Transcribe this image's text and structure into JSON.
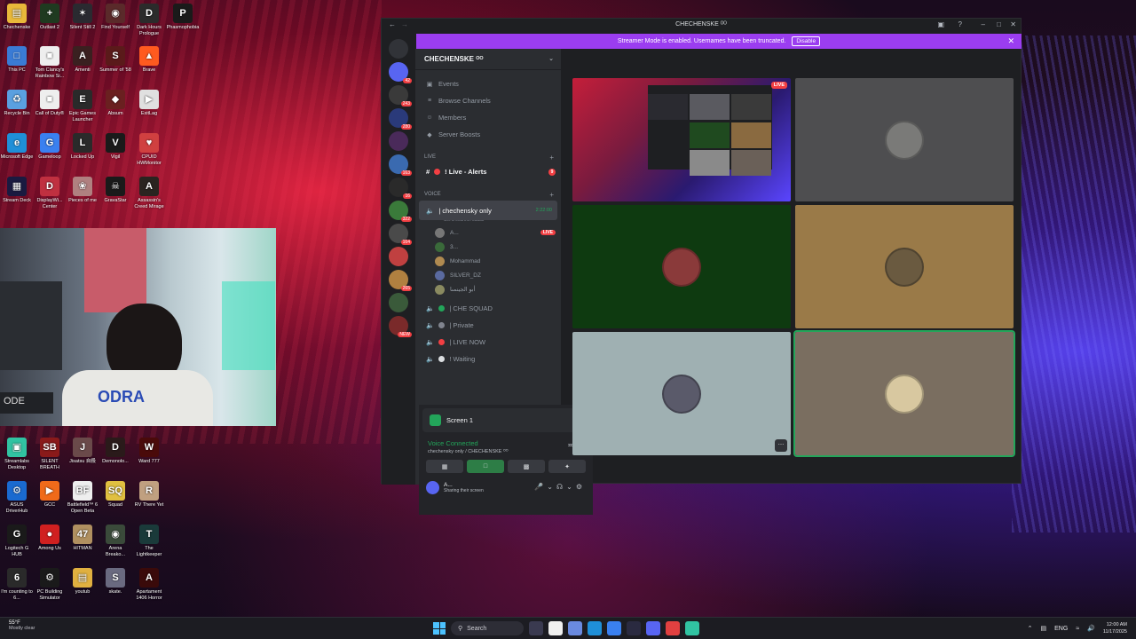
{
  "desktop": {
    "icons": [
      {
        "label": "Chechenske",
        "color": "#e8b83a",
        "glyph": "▤"
      },
      {
        "label": "Outlast 2",
        "color": "#1f3a20",
        "glyph": "+"
      },
      {
        "label": "Silent Still 2",
        "color": "#2a2a30",
        "glyph": "✶"
      },
      {
        "label": "Find Yourself",
        "color": "#5a2a2a",
        "glyph": "◉"
      },
      {
        "label": "Dark Hours Prologue",
        "color": "#2b2b2b",
        "glyph": "D"
      },
      {
        "label": "Phasmophobia",
        "color": "#1a1a1a",
        "glyph": "P"
      },
      {
        "label": "This PC",
        "color": "#3a7bd5",
        "glyph": "□"
      },
      {
        "label": "Tom Clancy's Rainbow Si...",
        "color": "#eeeeee",
        "glyph": "■"
      },
      {
        "label": "Amenti",
        "color": "#3a2020",
        "glyph": "A"
      },
      {
        "label": "Summer of '58",
        "color": "#5a1a1a",
        "glyph": "S"
      },
      {
        "label": "Brave",
        "color": "#ff5a1f",
        "glyph": "▲"
      },
      {
        "label": "Recycle Bin",
        "color": "#5aa0e0",
        "glyph": "♻"
      },
      {
        "label": "Call of Duty®",
        "color": "#eeeeee",
        "glyph": "■"
      },
      {
        "label": "Epic Games Launcher",
        "color": "#2a2a2a",
        "glyph": "E"
      },
      {
        "label": "Absum",
        "color": "#6a2020",
        "glyph": "◆"
      },
      {
        "label": "ExitLag",
        "color": "#e0e0e0",
        "glyph": "▶"
      },
      {
        "label": "Microsoft Edge",
        "color": "#1f8fd8",
        "glyph": "e"
      },
      {
        "label": "Gameloop",
        "color": "#3a80f0",
        "glyph": "G"
      },
      {
        "label": "Locked Up",
        "color": "#2a2a2a",
        "glyph": "L"
      },
      {
        "label": "Vigil",
        "color": "#1a1a1a",
        "glyph": "V"
      },
      {
        "label": "CPUID HWMonitor",
        "color": "#d04040",
        "glyph": "♥"
      },
      {
        "label": "Stream Deck",
        "color": "#1a1a40",
        "glyph": "▦"
      },
      {
        "label": "DisplayWi... Center",
        "color": "#c03040",
        "glyph": "D"
      },
      {
        "label": "Pieces of me",
        "color": "#b08080",
        "glyph": "❀"
      },
      {
        "label": "GravaStar",
        "color": "#1a1a1a",
        "glyph": "☠"
      },
      {
        "label": "Assassin's Creed Mirage",
        "color": "#2a2420",
        "glyph": "A"
      },
      {
        "label": "Streamlabs Desktop",
        "color": "#31c3a2",
        "glyph": "▣"
      },
      {
        "label": "SILENT BREATH",
        "color": "#8a1a1a",
        "glyph": "SB"
      },
      {
        "label": "Jisatsu 自殺",
        "color": "#6a4a4a",
        "glyph": "J"
      },
      {
        "label": "Demonolo...",
        "color": "#2a1a1a",
        "glyph": "D"
      },
      {
        "label": "Ward 777",
        "color": "#4a0a0a",
        "glyph": "W"
      },
      {
        "label": "ASUS DriverHub",
        "color": "#1a6ad0",
        "glyph": "⚙"
      },
      {
        "label": "GCC",
        "color": "#f06a1a",
        "glyph": "▶"
      },
      {
        "label": "Battlefield™ 6 Open Beta",
        "color": "#eeeeee",
        "glyph": "BF"
      },
      {
        "label": "Squad",
        "color": "#e0c040",
        "glyph": "SQ"
      },
      {
        "label": "RV There Yet",
        "color": "#c0a080",
        "glyph": "R"
      },
      {
        "label": "Logitech G HUB",
        "color": "#1a1a1a",
        "glyph": "G"
      },
      {
        "label": "Among Us",
        "color": "#d02020",
        "glyph": "●"
      },
      {
        "label": "HITMAN",
        "color": "#b09060",
        "glyph": "47"
      },
      {
        "label": "Arena Breako...",
        "color": "#3a4a3a",
        "glyph": "◉"
      },
      {
        "label": "The Lightkeeper",
        "color": "#1a3a3a",
        "glyph": "T"
      },
      {
        "label": "I'm counting to 6...",
        "color": "#2a2a2a",
        "glyph": "6"
      },
      {
        "label": "PC Building Simulator",
        "color": "#1a1a1a",
        "glyph": "⚙"
      },
      {
        "label": "youtub",
        "color": "#e0b040",
        "glyph": "▤"
      },
      {
        "label": "skate.",
        "color": "#6a6a80",
        "glyph": "S"
      },
      {
        "label": "Apartament 1406 Horror",
        "color": "#3a0a0a",
        "glyph": "A"
      }
    ]
  },
  "webcam": {
    "shirt_text": "ODRA",
    "cord_text": "ODE"
  },
  "discord": {
    "window_title": "CHECHENSKE ᴼᴼ",
    "banner_text": "Streamer Mode is enabled. Usernames have been truncated.",
    "banner_button": "Disable",
    "guild_badges": [
      "42",
      "243",
      "280",
      "",
      "163",
      "16",
      "322",
      "164",
      "",
      "265",
      "",
      "NEW"
    ],
    "server_name": "CHECHENSKE ᴼᴼ",
    "nav": [
      {
        "label": "Events",
        "icon": "▣"
      },
      {
        "label": "Browse Channels",
        "icon": "≡"
      },
      {
        "label": "Members",
        "icon": "☺"
      },
      {
        "label": "Server Boosts",
        "icon": "◆"
      }
    ],
    "cat_live": "LIVE",
    "live_channel": {
      "label": "! Live - Alerts",
      "count": "9"
    },
    "cat_voice": "VOICE",
    "voice_channel": {
      "label": "| chechensky only",
      "time": "2:22:00",
      "status": "Set a channel status"
    },
    "voice_users": [
      {
        "name": "A...",
        "live": "LIVE",
        "color": "#777"
      },
      {
        "name": "3...",
        "live": "",
        "color": "#3a6a3a"
      },
      {
        "name": "Mohammad",
        "live": "",
        "color": "#b08a50"
      },
      {
        "name": "SILVER_DZ",
        "live": "",
        "color": "#5a6aa0"
      },
      {
        "name": "أبو الجينمىا",
        "live": "",
        "color": "#8a8a60"
      }
    ],
    "other_channels": [
      {
        "label": "| CHE SQUAD",
        "dot": "#23a55a"
      },
      {
        "label": "| Private",
        "dot": "#80848e"
      },
      {
        "label": "| LIVE NOW",
        "dot": "#f23f43"
      },
      {
        "label": "! Waiting",
        "dot": "#dbdee1"
      }
    ],
    "screen_label": "Screen 1",
    "voice_connected": "Voice Connected",
    "voice_sub": "chechensky only / CHECHENSKE ᴼᴼ",
    "user_name": "A...",
    "user_status": "Sharing their screen",
    "stream_live": "LIVE",
    "more_label": "…",
    "tiles": [
      {
        "kind": "stream",
        "bg": "",
        "avatar": "#444"
      },
      {
        "kind": "user",
        "bg": "#4e4e50",
        "avatar": "#7a7a78"
      },
      {
        "kind": "user",
        "bg": "#0e3a10",
        "avatar": "#8a3a3a"
      },
      {
        "kind": "user",
        "bg": "#9a7a48",
        "avatar": "#6a5a40"
      },
      {
        "kind": "user",
        "bg": "#9fb0b2",
        "avatar": "#5a5a6a"
      },
      {
        "kind": "user",
        "bg": "#7a6e60",
        "avatar": "#d8c8a0"
      }
    ]
  },
  "taskbar": {
    "temp": "55°F",
    "weather": "Mostly clear",
    "search": "Search",
    "lang": "ENG",
    "time": "12:00 AM",
    "date": "11/17/2025",
    "apps": [
      "#3a3a50",
      "#f0f0f0",
      "#6a8ae0",
      "#1f8fd8",
      "#3a80f0",
      "#2a2a40",
      "#5865f2",
      "#e04040",
      "#31c3a2"
    ]
  }
}
